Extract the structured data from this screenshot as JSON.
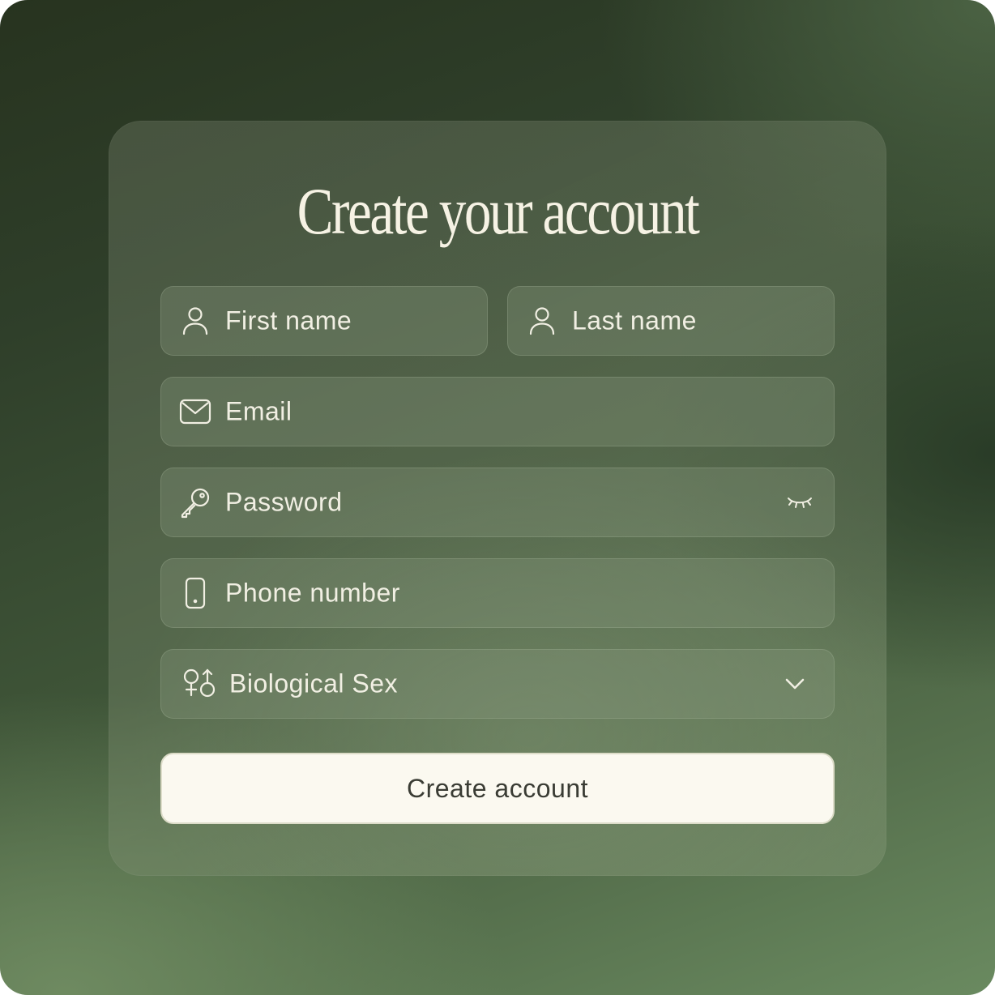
{
  "form": {
    "title": "Create your account",
    "fields": {
      "first_name": {
        "placeholder": "First name",
        "icon": "user-icon"
      },
      "last_name": {
        "placeholder": "Last name",
        "icon": "user-icon"
      },
      "email": {
        "placeholder": "Email",
        "icon": "envelope-icon"
      },
      "password": {
        "placeholder": "Password",
        "icon": "key-icon",
        "toggle_icon": "eye-closed-icon"
      },
      "phone": {
        "placeholder": "Phone number",
        "icon": "phone-icon"
      },
      "sex": {
        "placeholder": "Biological Sex",
        "icon": "gender-icon",
        "dropdown_icon": "chevron-down-icon"
      }
    },
    "submit_label": "Create account"
  },
  "colors": {
    "text_light": "#f1efe3",
    "button_bg": "#fbf9f0",
    "button_text": "#3a3c34"
  }
}
